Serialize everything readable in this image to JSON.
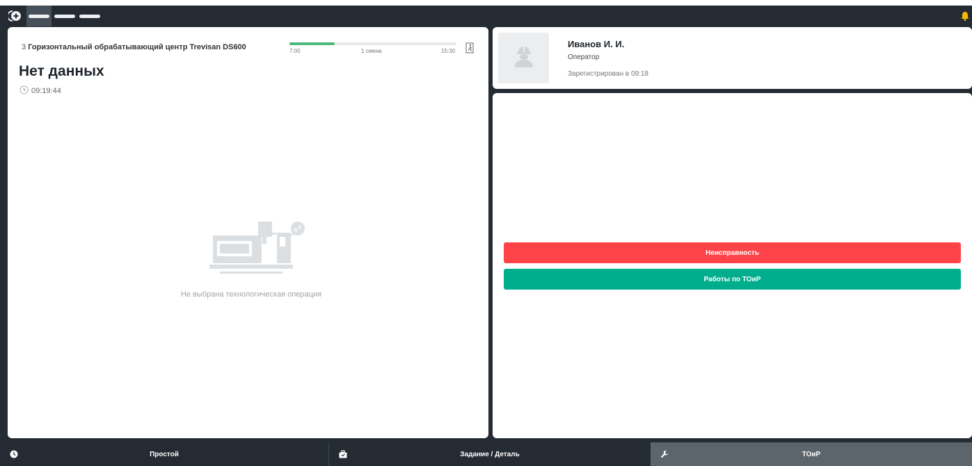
{
  "header": {
    "logo_icon": "plus-circle-logo-icon",
    "bell_icon": "bell-icon",
    "accent_color": "#f5b800"
  },
  "machine": {
    "number": "3",
    "name": "Горизонтальный обрабатывающий центр Trevisan DS600",
    "status": "Нет данных",
    "time": "09:19:44",
    "empty_message": "Не выбрана технологическая операция"
  },
  "shift": {
    "start": "7:00",
    "end": "15:30",
    "name": "1 смена",
    "progress": 0.27,
    "color": "#4cb87a"
  },
  "user": {
    "name": "Иванов И. И.",
    "role": "Оператор",
    "registered": "Зарегистрирован в 09:18"
  },
  "actions": {
    "fault_label": "Неисправность",
    "fault_color": "#ff4449",
    "maintenance_label": "Работы по ТОиР",
    "maintenance_color": "#00ae8d"
  },
  "nav": {
    "items": [
      {
        "label": "Простой",
        "icon": "clock-icon",
        "active": false
      },
      {
        "label": "Задание / Деталь",
        "icon": "briefcase-icon",
        "active": false
      },
      {
        "label": "ТОиР",
        "icon": "wrench-icon",
        "active": true
      }
    ]
  }
}
